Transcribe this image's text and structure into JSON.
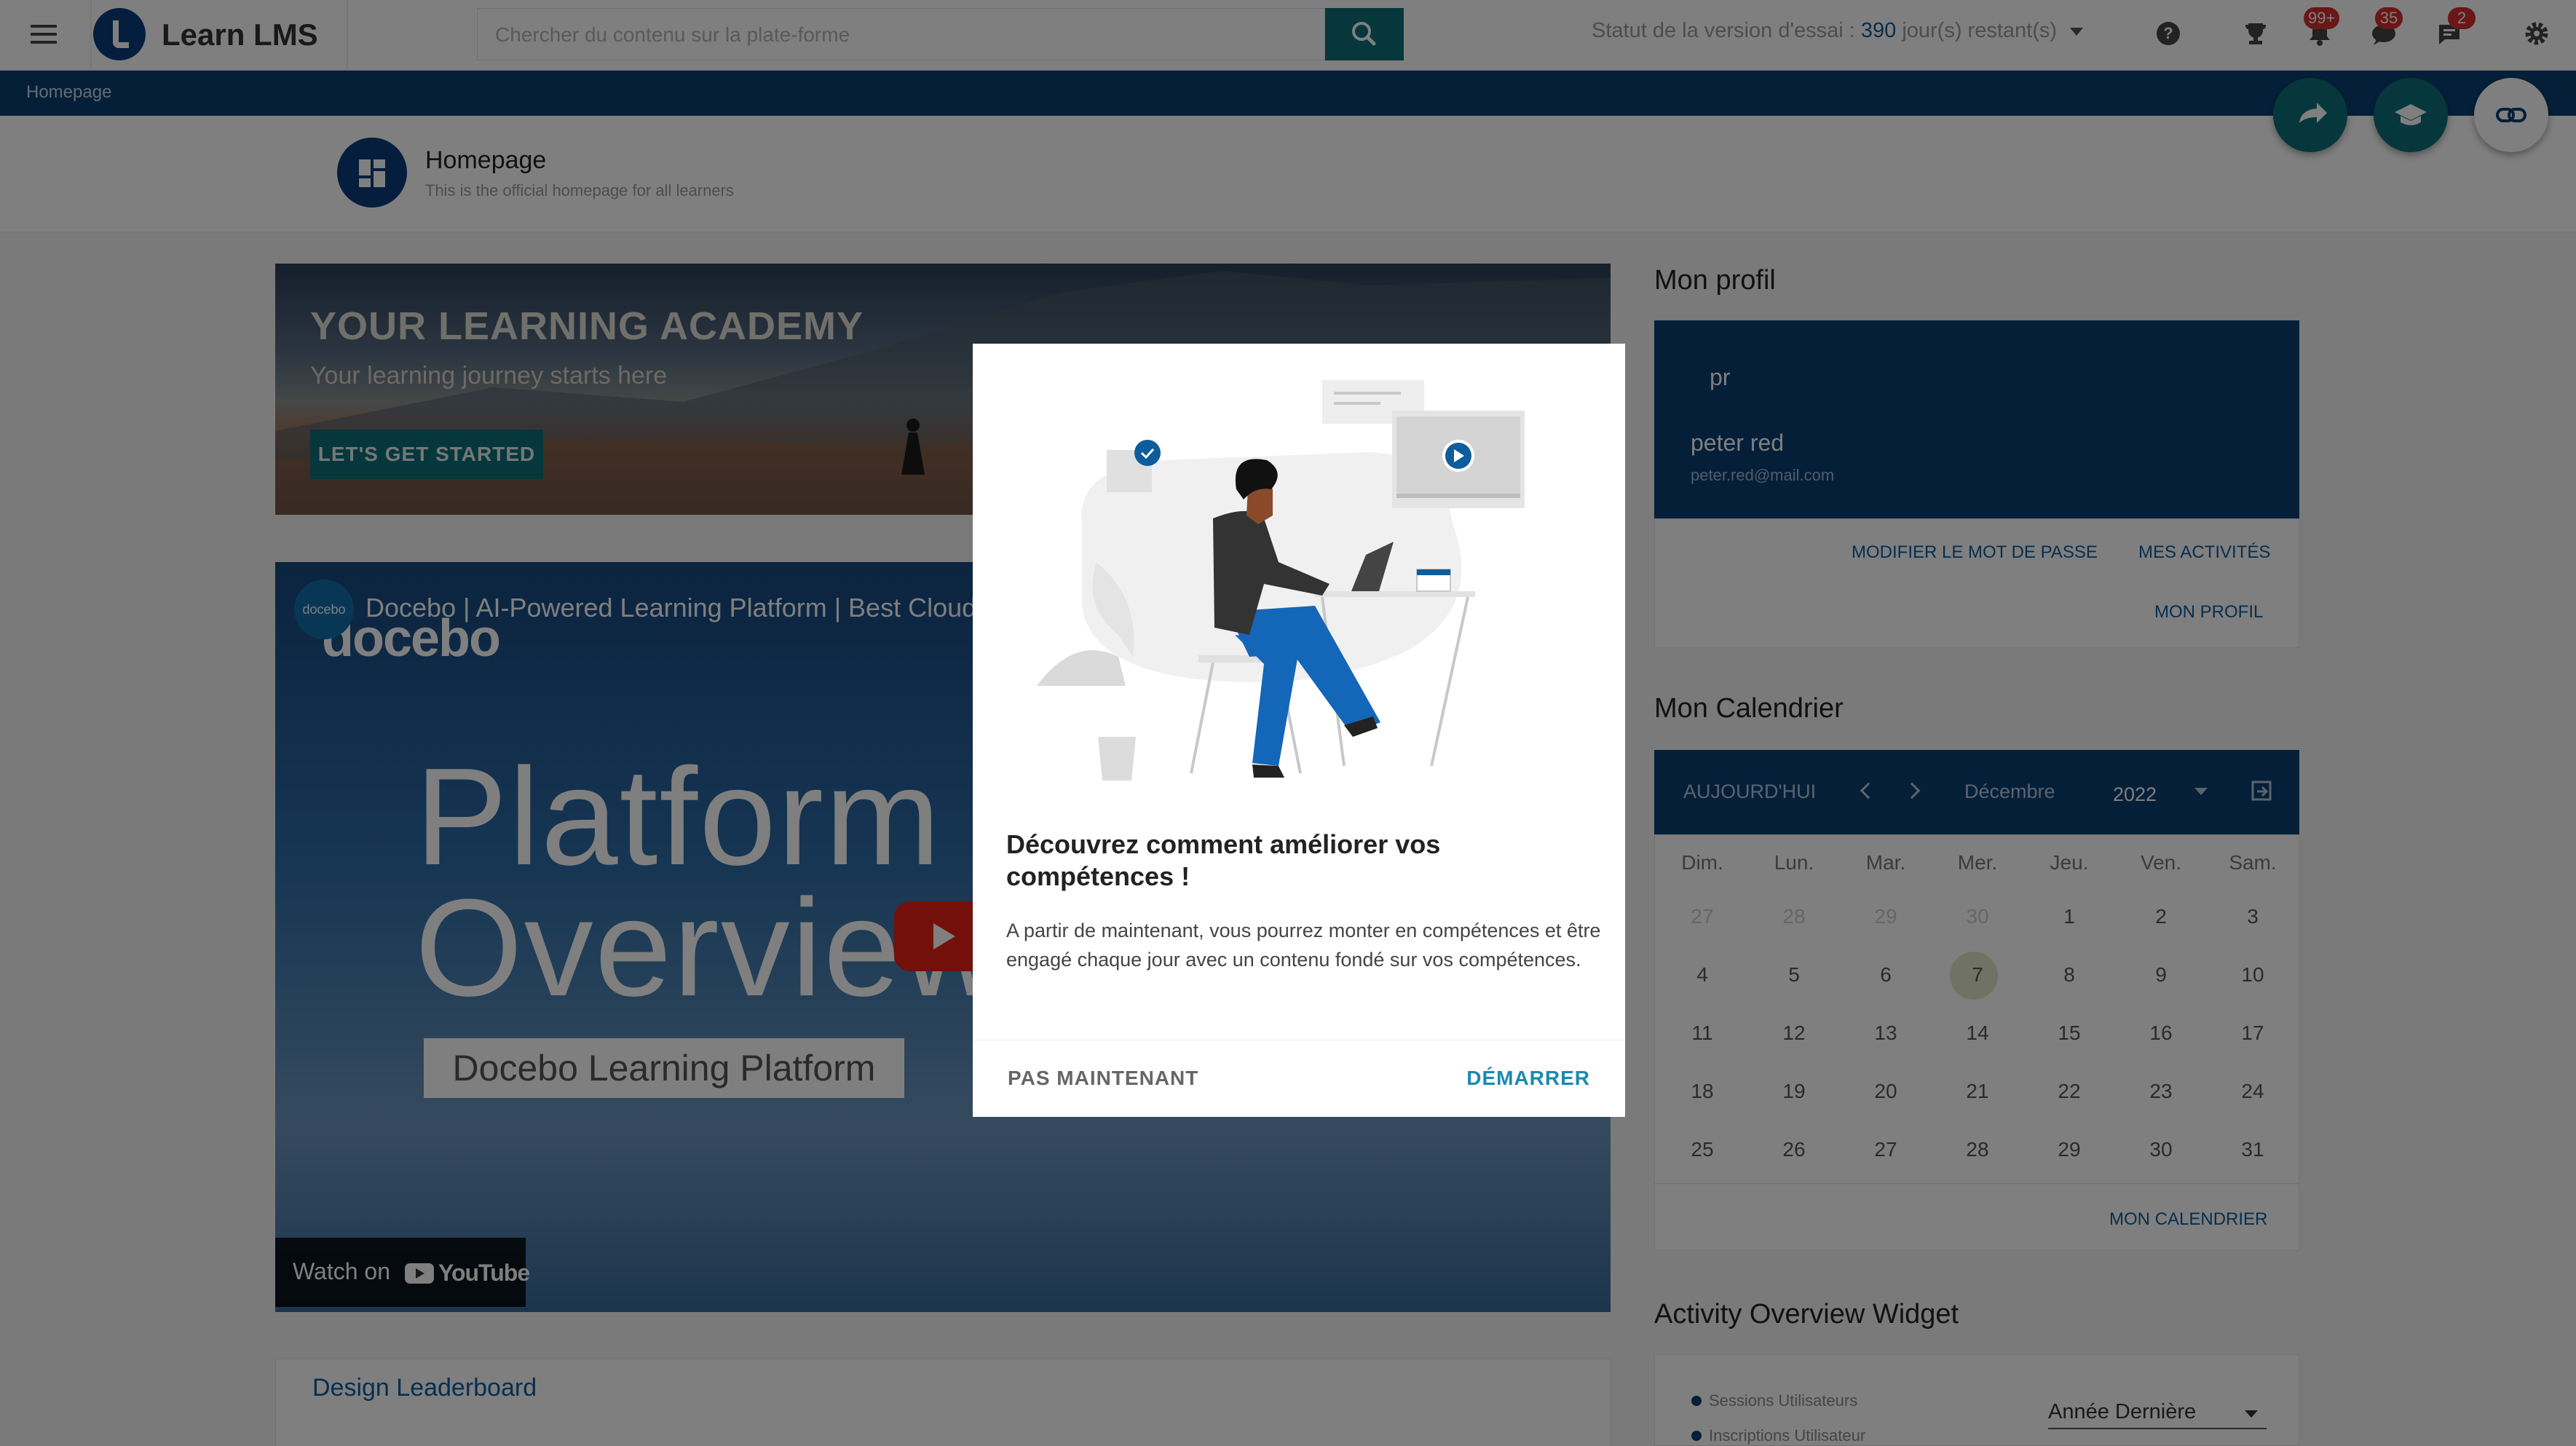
{
  "app": {
    "title": "Learn LMS"
  },
  "search": {
    "placeholder": "Chercher du contenu sur la plate-forme"
  },
  "trial": {
    "prefix": "Statut de la version d'essai :",
    "days": "390",
    "suffix": "jour(s) restant(s)"
  },
  "top_icons": [
    "help-icon",
    "trophy-icon",
    "bell-icon",
    "chat-icon",
    "message-icon",
    "gear-icon"
  ],
  "badges": {
    "notifications": "99+",
    "chat": "35",
    "messages": "2"
  },
  "breadcrumb": {
    "label": "Homepage"
  },
  "page_header": {
    "title": "Homepage",
    "subtitle": "This is the official homepage for all learners"
  },
  "hero": {
    "title": "YOUR LEARNING ACADEMY",
    "subtitle": "Your learning journey starts here",
    "cta": "LET'S GET STARTED"
  },
  "video": {
    "channel": "docebo",
    "title": "Docebo | AI-Powered Learning Platform | Best Cloud",
    "brand": "docebo",
    "line1": "Platform",
    "line2": "Overview",
    "boxed": "Docebo Learning Platform",
    "watch": "Watch on",
    "youtube": "YouTube"
  },
  "leaderboard": {
    "title": "Design Leaderboard"
  },
  "profile": {
    "heading": "Mon profil",
    "initials": "pr",
    "name": "peter red",
    "email": "peter.red@mail.com",
    "change_password": "MODIFIER LE MOT DE PASSE",
    "activities": "MES ACTIVITÉS",
    "my_profile": "MON PROFIL"
  },
  "calendar": {
    "heading": "Mon Calendrier",
    "today": "AUJOURD'HUI",
    "month": "Décembre",
    "year": "2022",
    "days_of_week": [
      "Dim.",
      "Lun.",
      "Mar.",
      "Mer.",
      "Jeu.",
      "Ven.",
      "Sam."
    ],
    "weeks": [
      [
        "27",
        "28",
        "29",
        "30",
        "1",
        "2",
        "3"
      ],
      [
        "4",
        "5",
        "6",
        "7",
        "8",
        "9",
        "10"
      ],
      [
        "11",
        "12",
        "13",
        "14",
        "15",
        "16",
        "17"
      ],
      [
        "18",
        "19",
        "20",
        "21",
        "22",
        "23",
        "24"
      ],
      [
        "25",
        "26",
        "27",
        "28",
        "29",
        "30",
        "31"
      ]
    ],
    "link": "MON CALENDRIER"
  },
  "activity": {
    "heading": "Activity Overview Widget",
    "legend1": "Sessions Utilisateurs",
    "legend2": "Inscriptions Utilisateur",
    "period": "Année Dernière"
  },
  "modal": {
    "title": "Découvrez comment améliorer vos compétences !",
    "body": "A partir de maintenant, vous pourrez monter en compétences et être engagé chaque jour avec un contenu fondé sur vos compétences.",
    "dismiss": "PAS MAINTENANT",
    "start": "DÉMARRER"
  },
  "colors": {
    "primary": "#0a3f73",
    "accent": "#0d6e79",
    "link": "#0d5c9e",
    "badge": "#d32f2f"
  }
}
